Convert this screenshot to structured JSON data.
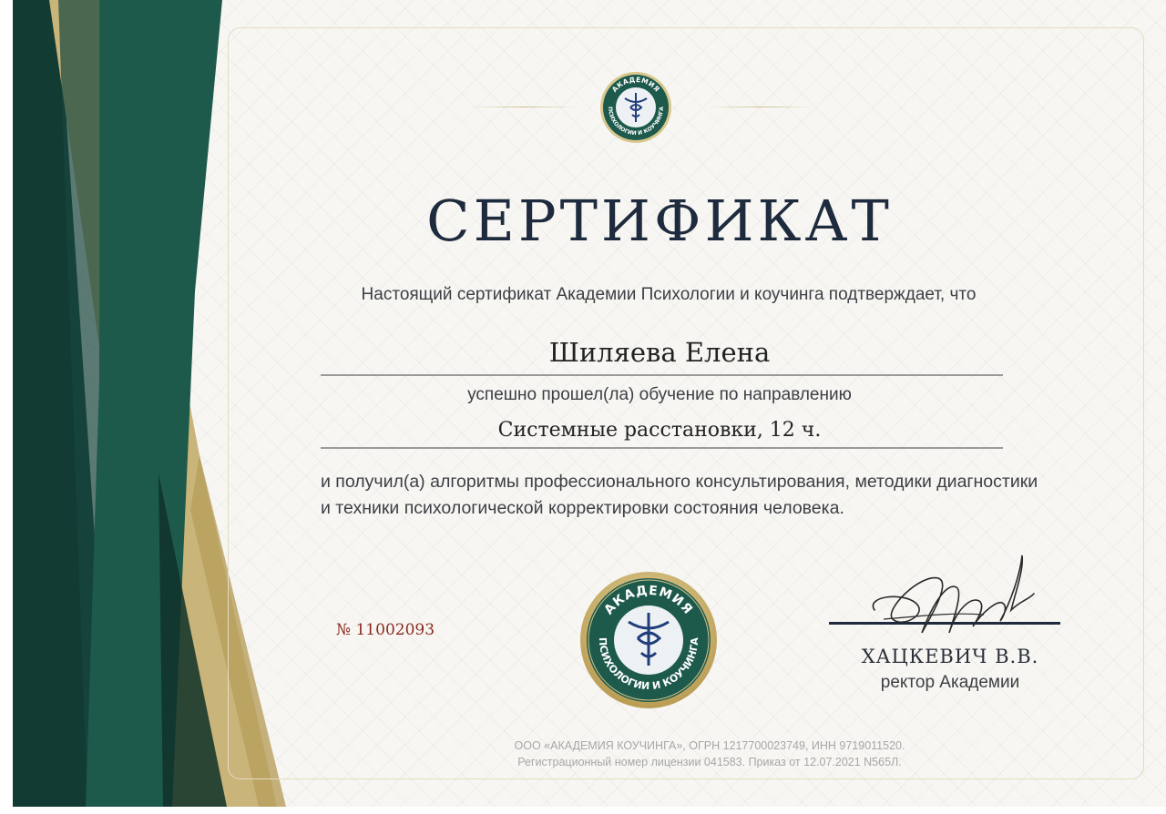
{
  "certificate": {
    "title": "СЕРТИФИКАТ",
    "intro": "Настоящий сертификат Академии Психологии и коучинга подтверждает, что",
    "recipient_name": "Шиляева Елена",
    "passed_text": "успешно прошел(ла) обучение по направлению",
    "course": "Системные расстановки, 12 ч.",
    "description": "и получил(а) алгоритмы профессионального консультирования, методики диагностики и техники психологической корректировки состояния человека.",
    "number": "№ 11002093",
    "rector_name": "ХАЦКЕВИЧ В.В.",
    "rector_role": "ректор Академии",
    "footer_line1": "ООО «АКАДЕМИЯ КОУЧИНГА», ОГРН 1217700023749, ИНН 9719011520.",
    "footer_line2": "Регистрационный номер лицензии 041583. Приказ от 12.07.2021 N565Л."
  },
  "logo": {
    "text_top": "АКАДЕМИЯ",
    "text_bottom": "ПСИХОЛОГИИ И КОУЧИНГА"
  },
  "colors": {
    "dark_green": "#1d5a4c",
    "deep_green": "#123b33",
    "gold": "#c9b47a",
    "navy": "#1e2a3d",
    "number_red": "#8b2a1e"
  },
  "icons": [
    "academy-logo-icon",
    "academy-seal-icon",
    "caduceus-icon",
    "signature-icon"
  ]
}
